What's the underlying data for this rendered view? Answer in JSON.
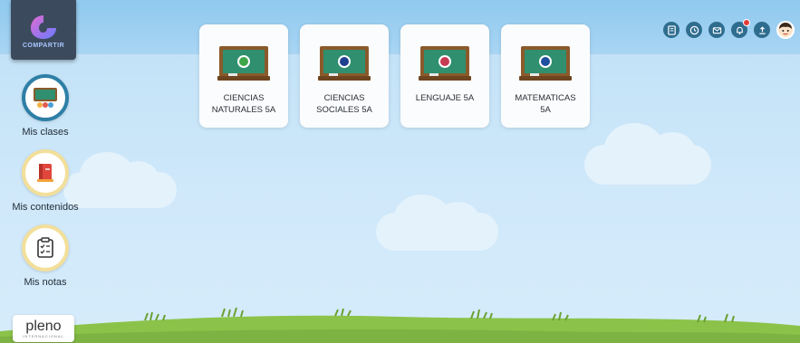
{
  "app": {
    "brand_text": "COMPARTIR",
    "footer_brand": "pleno",
    "footer_brand_sub": "INTERNACIONAL"
  },
  "sidebar": {
    "items": [
      {
        "label": "Mis clases",
        "icon": "classroom-icon",
        "active": true
      },
      {
        "label": "Mis contenidos",
        "icon": "books-icon",
        "active": false
      },
      {
        "label": "Mis notas",
        "icon": "clipboard-icon",
        "active": false
      }
    ]
  },
  "classes": [
    {
      "title": "CIENCIAS\nNATURALES 5A",
      "icon": "chalkboard-icon",
      "emblem_color": "#3fa54a"
    },
    {
      "title": "CIENCIAS\nSOCIALES 5A",
      "icon": "chalkboard-icon",
      "emblem_color": "#1f3f8f"
    },
    {
      "title": "LENGUAJE 5A",
      "icon": "chalkboard-icon",
      "emblem_color": "#c63a52"
    },
    {
      "title": "MATEMATICAS\n5A",
      "icon": "chalkboard-icon",
      "emblem_color": "#1f4f9f"
    }
  ],
  "topbar": {
    "icons": [
      "notebook-icon",
      "clock-icon",
      "mail-icon",
      "bell-icon",
      "upload-icon",
      "user-avatar-icon"
    ],
    "notification_badge": true
  },
  "colors": {
    "sky": "#cfe8fa",
    "sky_top": "#8fc9ef",
    "grass": "#8bc34a",
    "icon_blue": "#2f6d8f",
    "active_ring": "#2e7fa6",
    "inactive_ring": "#f2df9a",
    "board_green": "#2f8f6f",
    "board_frame": "#8b5a2b"
  }
}
